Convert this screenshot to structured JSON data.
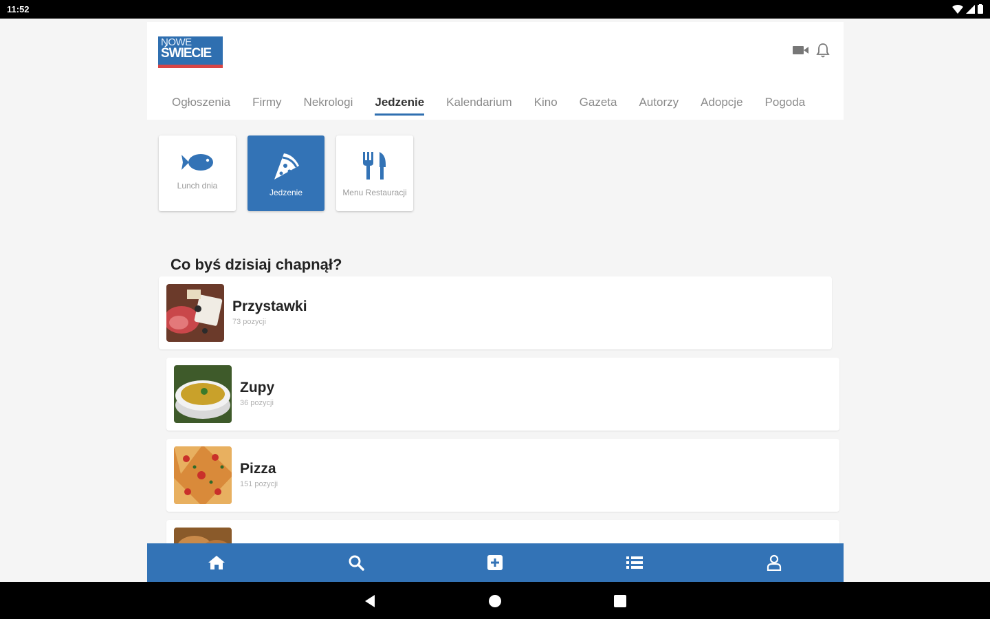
{
  "status_bar": {
    "time": "11:52"
  },
  "logo": {
    "line1": "NOWE",
    "line2": "ŚWIECIE"
  },
  "tabs": [
    {
      "label": "Ogłoszenia"
    },
    {
      "label": "Firmy"
    },
    {
      "label": "Nekrologi"
    },
    {
      "label": "Jedzenie",
      "active": true
    },
    {
      "label": "Kalendarium"
    },
    {
      "label": "Kino"
    },
    {
      "label": "Gazeta"
    },
    {
      "label": "Autorzy"
    },
    {
      "label": "Adopcje"
    },
    {
      "label": "Pogoda"
    }
  ],
  "tiles": [
    {
      "label": "Lunch dnia",
      "icon": "fish-icon"
    },
    {
      "label": "Jedzenie",
      "icon": "pizza-icon",
      "active": true
    },
    {
      "label": "Menu Restauracji",
      "icon": "cutlery-icon"
    }
  ],
  "section": {
    "title": "Co byś dzisiaj chapnął?"
  },
  "categories": [
    {
      "name": "Przystawki",
      "count": "73 pozycji"
    },
    {
      "name": "Zupy",
      "count": "36 pozycji"
    },
    {
      "name": "Pizza",
      "count": "151 pozycji"
    }
  ],
  "bottom_nav": [
    {
      "icon": "home-icon"
    },
    {
      "icon": "search-icon"
    },
    {
      "icon": "add-box-icon"
    },
    {
      "icon": "list-icon"
    },
    {
      "icon": "user-icon"
    }
  ],
  "colors": {
    "accent": "#3373b6",
    "logo_red": "#d94545"
  }
}
